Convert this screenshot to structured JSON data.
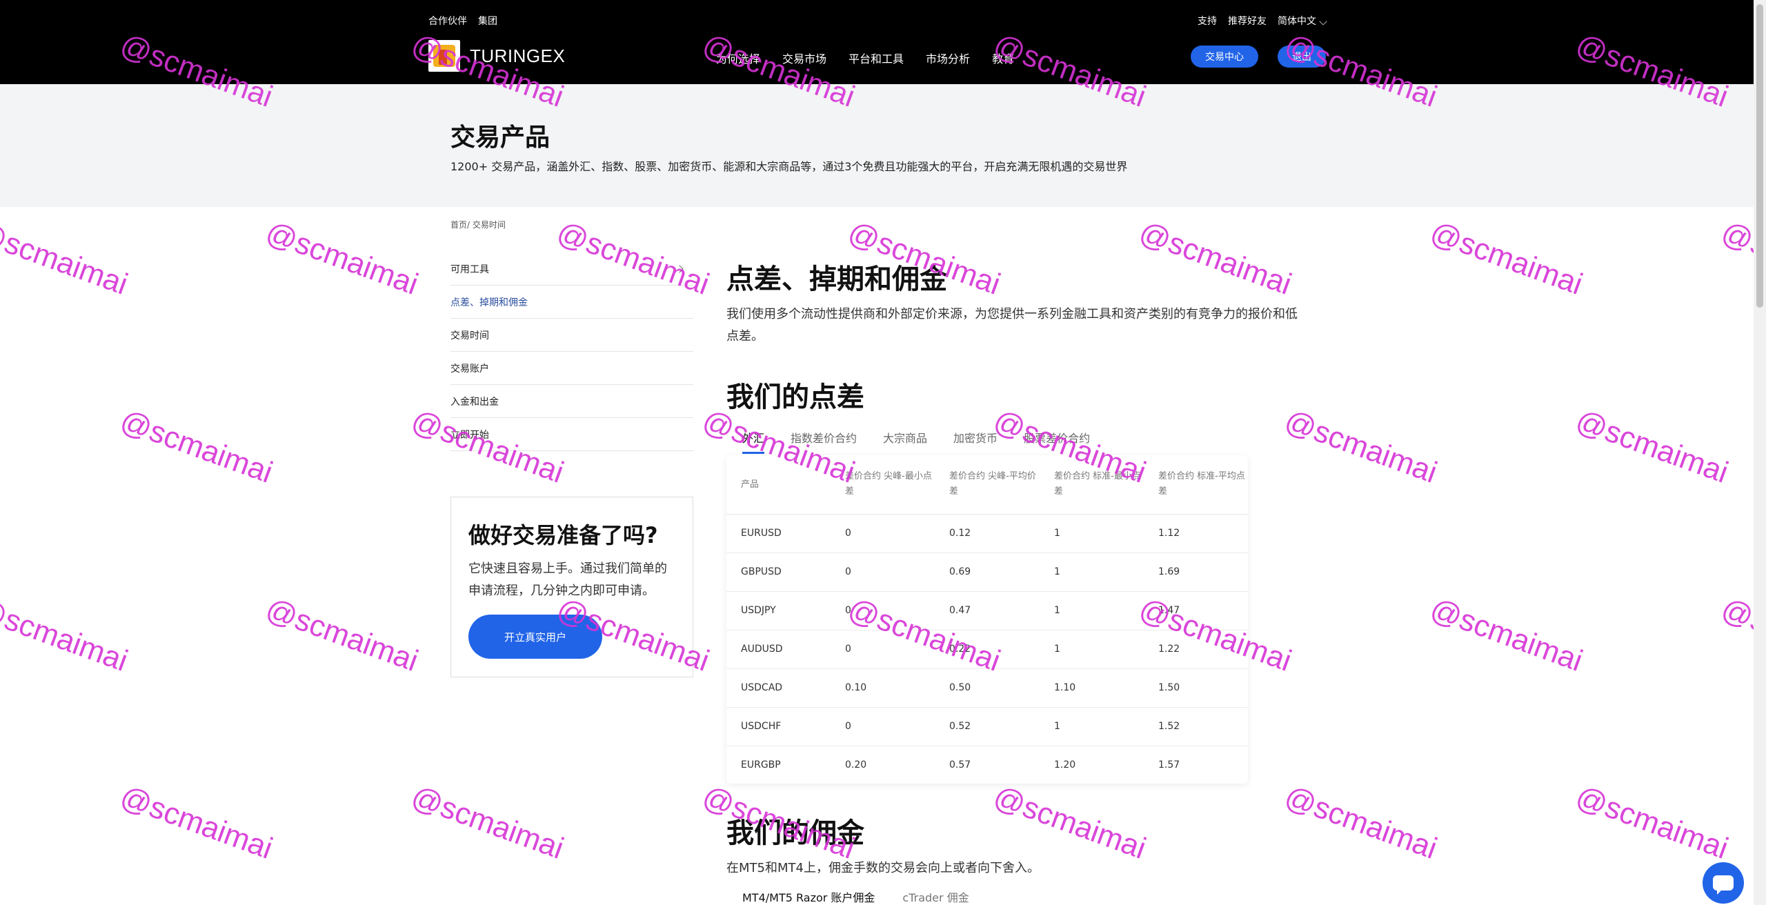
{
  "header": {
    "top_links": [
      "合作伙伴",
      "集团"
    ],
    "top_right": [
      "支持",
      "推荐好友",
      "简体中文"
    ],
    "logo_text": "TURINGEX",
    "nav": [
      "为何选择",
      "交易市场",
      "平台和工具",
      "市场分析",
      "教育"
    ],
    "trade_center_label": "交易中心",
    "logout_label": "退出"
  },
  "hero": {
    "title": "交易产品",
    "subtitle": "1200+ 交易产品，涵盖外汇、指数、股票、加密货币、能源和大宗商品等，通过3个免费且功能强大的平台，开启充满无限机遇的交易世界"
  },
  "breadcrumb": "首页/ 交易时间",
  "sidebar": {
    "items": [
      {
        "label": "可用工具"
      },
      {
        "label": "点差、掉期和佣金"
      },
      {
        "label": "交易时间"
      },
      {
        "label": "交易账户"
      },
      {
        "label": "入金和出金"
      },
      {
        "label": "立即开始"
      }
    ]
  },
  "cta": {
    "title": "做好交易准备了吗?",
    "text": "它快速且容易上手。通过我们简单的申请流程，几分钟之内即可申请。",
    "button_label": "开立真实用户"
  },
  "main": {
    "title": "点差、掉期和佣金",
    "description": "我们使用多个流动性提供商和外部定价来源，为您提供一系列金融工具和资产类别的有竞争力的报价和低点差。",
    "spread_title": "我们的点差",
    "tabs": [
      "外汇",
      "指数差价合约",
      "大宗商品",
      "加密货币",
      "股票差价合约"
    ],
    "table": {
      "headers": [
        "产品",
        "差价合约 尖峰-最小点差",
        "差价合约 尖峰-平均价差",
        "差价合约 标准-最小点差",
        "差价合约 标准-平均点差"
      ],
      "rows": [
        [
          "EURUSD",
          "0",
          "0.12",
          "1",
          "1.12"
        ],
        [
          "GBPUSD",
          "0",
          "0.69",
          "1",
          "1.69"
        ],
        [
          "USDJPY",
          "0",
          "0.47",
          "1",
          "1.47"
        ],
        [
          "AUDUSD",
          "0",
          "0.22",
          "1",
          "1.22"
        ],
        [
          "USDCAD",
          "0.10",
          "0.50",
          "1.10",
          "1.50"
        ],
        [
          "USDCHF",
          "0",
          "0.52",
          "1",
          "1.52"
        ],
        [
          "EURGBP",
          "0.20",
          "0.57",
          "1.20",
          "1.57"
        ]
      ]
    },
    "commission_title": "我们的佣金",
    "commission_desc": "在MT5和MT4上，佣金手数的交易会向上或者向下舍入。",
    "commission_tabs": [
      "MT4/MT5 Razor 账户佣金",
      "cTrader 佣金"
    ]
  },
  "watermark_text": "@scmaimai",
  "colors": {
    "accent": "#2164e8",
    "header_bg": "#000000",
    "hero_bg": "#f3f4f5",
    "watermark": "#d633d6"
  }
}
